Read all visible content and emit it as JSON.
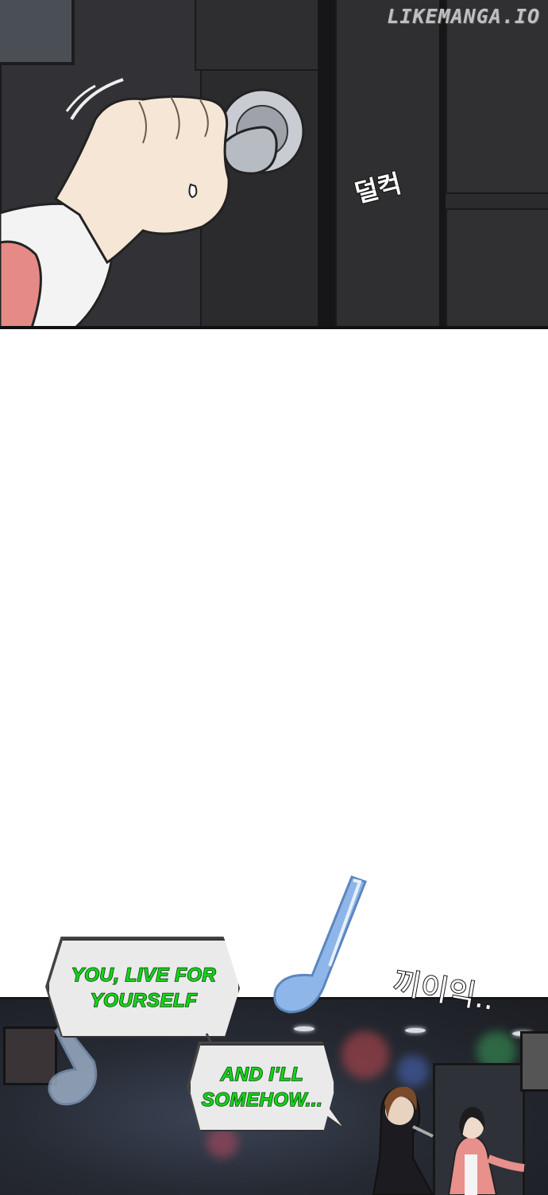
{
  "watermark": "LIKEMANGA.IO",
  "sfx": {
    "door_click": "덜컥",
    "door_creak": "끼이익.."
  },
  "bubbles": {
    "first": "YOU, LIVE FOR\nYOURSELF",
    "second": "AND I'LL\nSOMEHOW..."
  },
  "colors": {
    "dialogue_text": "#14d41a",
    "bubble_fill": "#eaeaea",
    "music_note": "#8fb6e8"
  },
  "icons": [
    "music-note-icon",
    "music-note-icon"
  ]
}
